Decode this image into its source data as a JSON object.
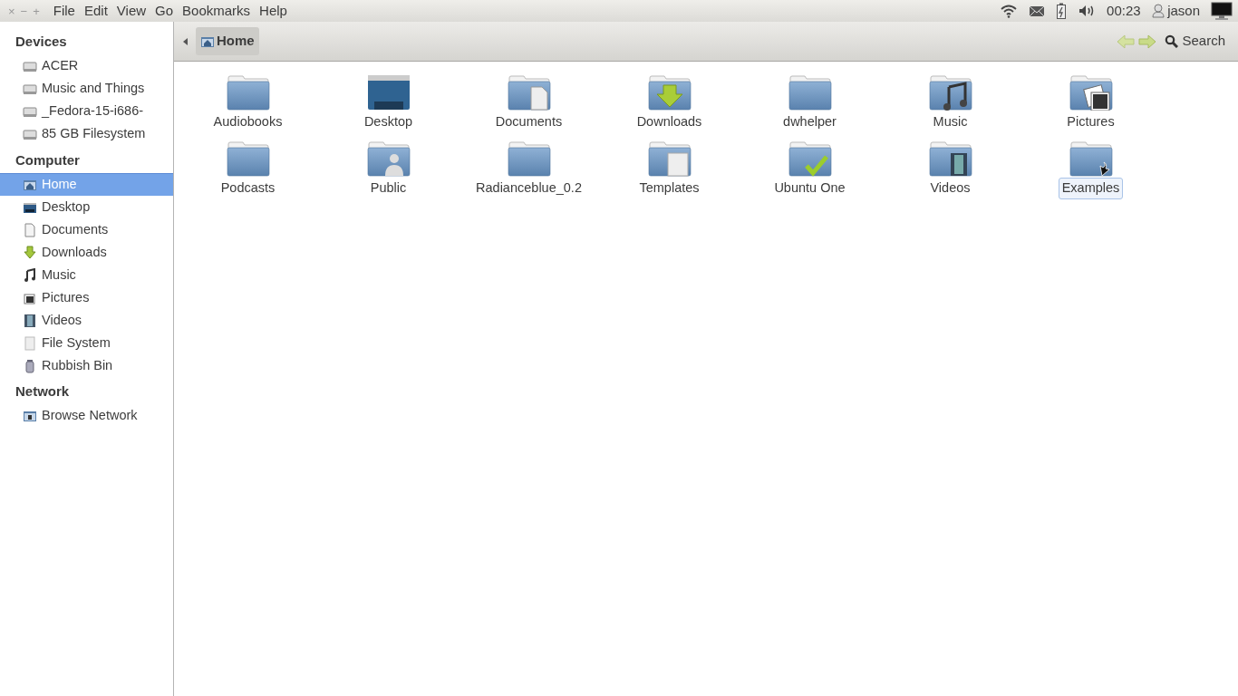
{
  "window_controls": [
    "×",
    "−",
    "+"
  ],
  "menu": [
    "File",
    "Edit",
    "View",
    "Go",
    "Bookmarks",
    "Help"
  ],
  "indicators": {
    "time": "00:23",
    "user": "jason"
  },
  "toolbar": {
    "path": [
      {
        "label": "Home",
        "selected": true
      }
    ],
    "search": "Search"
  },
  "sidebar": [
    {
      "heading": "Devices",
      "items": [
        {
          "label": "ACER",
          "kind": "drive",
          "selected": false
        },
        {
          "label": "Music and Things",
          "kind": "drive",
          "selected": false
        },
        {
          "label": "_Fedora-15-i686-",
          "kind": "drive",
          "selected": false
        },
        {
          "label": "85 GB Filesystem",
          "kind": "drive",
          "selected": false
        }
      ]
    },
    {
      "heading": "Computer",
      "items": [
        {
          "label": "Home",
          "kind": "home",
          "selected": true
        },
        {
          "label": "Desktop",
          "kind": "desktop",
          "selected": false
        },
        {
          "label": "Documents",
          "kind": "documents",
          "selected": false
        },
        {
          "label": "Downloads",
          "kind": "downloads",
          "selected": false
        },
        {
          "label": "Music",
          "kind": "music",
          "selected": false
        },
        {
          "label": "Pictures",
          "kind": "pictures",
          "selected": false
        },
        {
          "label": "Videos",
          "kind": "videos",
          "selected": false
        },
        {
          "label": "File System",
          "kind": "filesystem",
          "selected": false
        },
        {
          "label": "Rubbish Bin",
          "kind": "trash",
          "selected": false
        }
      ]
    },
    {
      "heading": "Network",
      "items": [
        {
          "label": "Browse Network",
          "kind": "network",
          "selected": false
        }
      ]
    }
  ],
  "files": [
    {
      "name": "Audiobooks",
      "kind": "plain",
      "selected": false
    },
    {
      "name": "Desktop",
      "kind": "desktop",
      "selected": false
    },
    {
      "name": "Documents",
      "kind": "documents",
      "selected": false
    },
    {
      "name": "Downloads",
      "kind": "downloads",
      "selected": false
    },
    {
      "name": "dwhelper",
      "kind": "plain",
      "selected": false
    },
    {
      "name": "Music",
      "kind": "music",
      "selected": false
    },
    {
      "name": "Pictures",
      "kind": "pictures",
      "selected": false
    },
    {
      "name": "Podcasts",
      "kind": "plain",
      "selected": false
    },
    {
      "name": "Public",
      "kind": "public",
      "selected": false
    },
    {
      "name": "Radianceblue_0.2",
      "kind": "plain",
      "selected": false
    },
    {
      "name": "Templates",
      "kind": "templates",
      "selected": false
    },
    {
      "name": "Ubuntu One",
      "kind": "check",
      "selected": false
    },
    {
      "name": "Videos",
      "kind": "videos",
      "selected": false
    },
    {
      "name": "Examples",
      "kind": "link",
      "selected": true
    }
  ]
}
